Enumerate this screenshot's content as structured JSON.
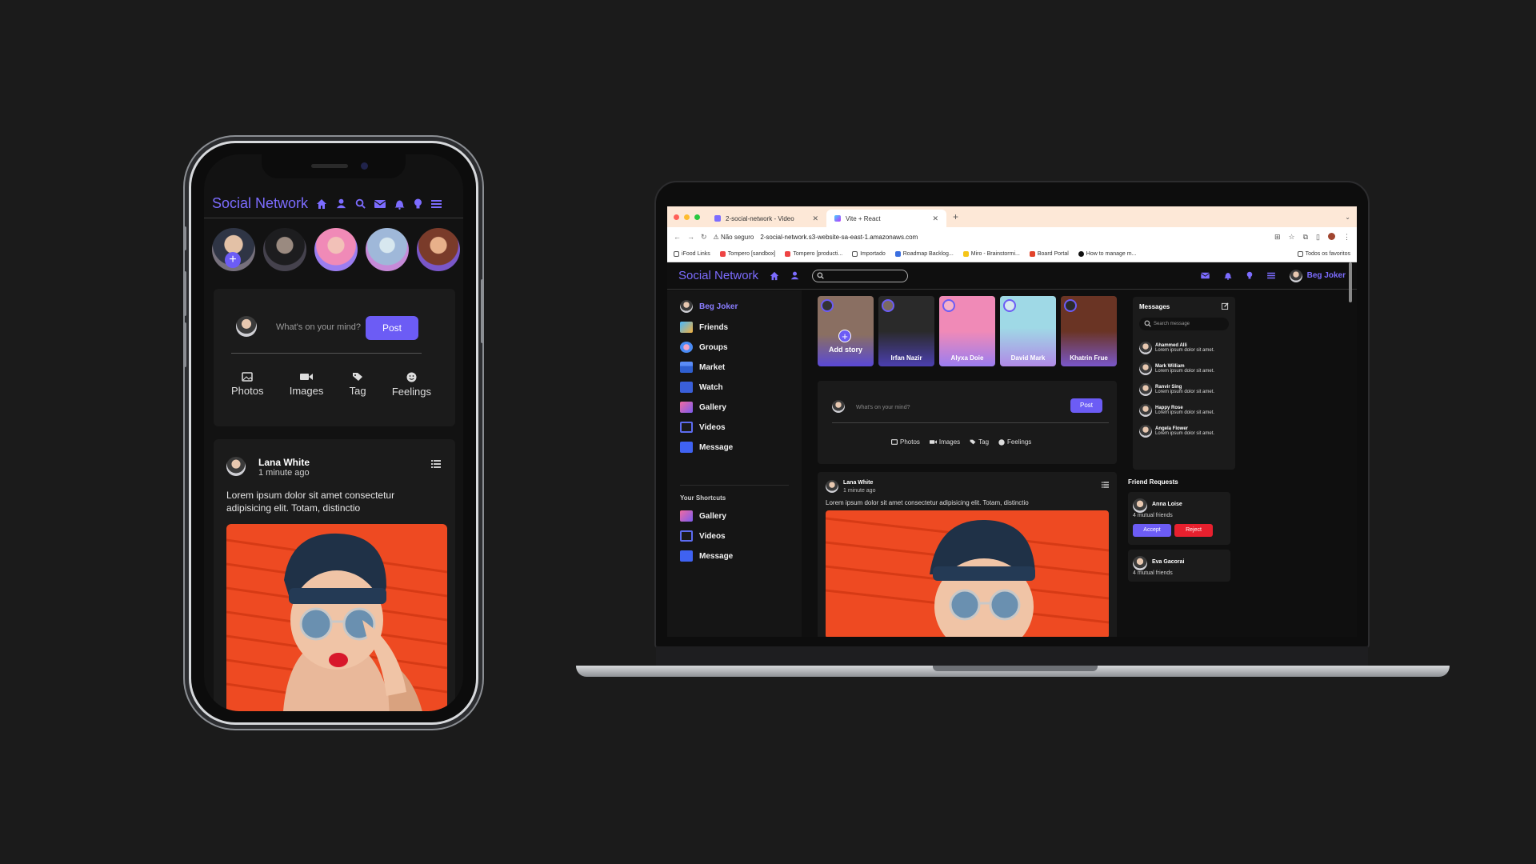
{
  "app": {
    "brand": "Social Network",
    "user_name": "Beg Joker",
    "accent": "#6c5cf5"
  },
  "phone": {
    "compose": {
      "placeholder": "What's on your mind?",
      "post_label": "Post",
      "actions": [
        {
          "label": "Photos",
          "icon": "photo-icon"
        },
        {
          "label": "Images",
          "icon": "video-icon"
        },
        {
          "label": "Tag",
          "icon": "tag-icon"
        },
        {
          "label": "Feelings",
          "icon": "smile-icon"
        }
      ]
    },
    "post": {
      "author": "Lana White",
      "time": "1 minute ago",
      "text": "Lorem ipsum dolor sit amet consectetur adipisicing elit. Totam, distinctio"
    }
  },
  "browser": {
    "tabs": [
      {
        "title": "2-social-network - Video",
        "active": false
      },
      {
        "title": "Vite + React",
        "active": true
      }
    ],
    "not_secure": "Não seguro",
    "url": "2-social-network.s3-website-sa-east-1.amazonaws.com",
    "bookmarks": [
      "iFood Links",
      "Tompero [sandbox]",
      "Tompero [producti...",
      "Importado",
      "Roadmap Backlog...",
      "Miro - Brainstormi...",
      "Board Portal",
      "How to manage m..."
    ],
    "bookmarks_all": "Todos os favoritos"
  },
  "sidebar": {
    "items": [
      "Friends",
      "Groups",
      "Market",
      "Watch",
      "Gallery",
      "Videos",
      "Message"
    ],
    "shortcuts_title": "Your Shortcuts",
    "shortcuts": [
      "Gallery",
      "Videos",
      "Message"
    ]
  },
  "stories": {
    "add_label": "Add story",
    "items": [
      "Irfan Nazir",
      "Alyxa Doie",
      "David Mark",
      "Khatrin Frue"
    ]
  },
  "compose": {
    "placeholder": "What's on your mind?",
    "post_label": "Post",
    "actions": [
      "Photos",
      "Images",
      "Tag",
      "Feelings"
    ]
  },
  "post": {
    "author": "Lana White",
    "time": "1 minute ago",
    "text": "Lorem ipsum dolor sit amet consectetur adipisicing elit. Totam, distinctio"
  },
  "messages": {
    "title": "Messages",
    "search_placeholder": "Search message",
    "items": [
      {
        "name": "Ahammed Alli",
        "text": "Lorem ipsum dolor sit amet."
      },
      {
        "name": "Mark William",
        "text": "Lorem ipsum dolor sit amet."
      },
      {
        "name": "Ranvir Sing",
        "text": "Lorem ipsum dolor sit amet."
      },
      {
        "name": "Happy Rose",
        "text": "Lorem ipsum dolor sit amet."
      },
      {
        "name": "Angela Flower",
        "text": "Lorem ipsum dolor sit amet."
      }
    ]
  },
  "friend_requests": {
    "title": "Friend Requests",
    "items": [
      {
        "name": "Anna Loise",
        "mutual": "4 mutual friends",
        "accept": "Accept",
        "reject": "Reject"
      },
      {
        "name": "Eva Gacorai",
        "mutual": "4 mutual friends"
      }
    ]
  }
}
